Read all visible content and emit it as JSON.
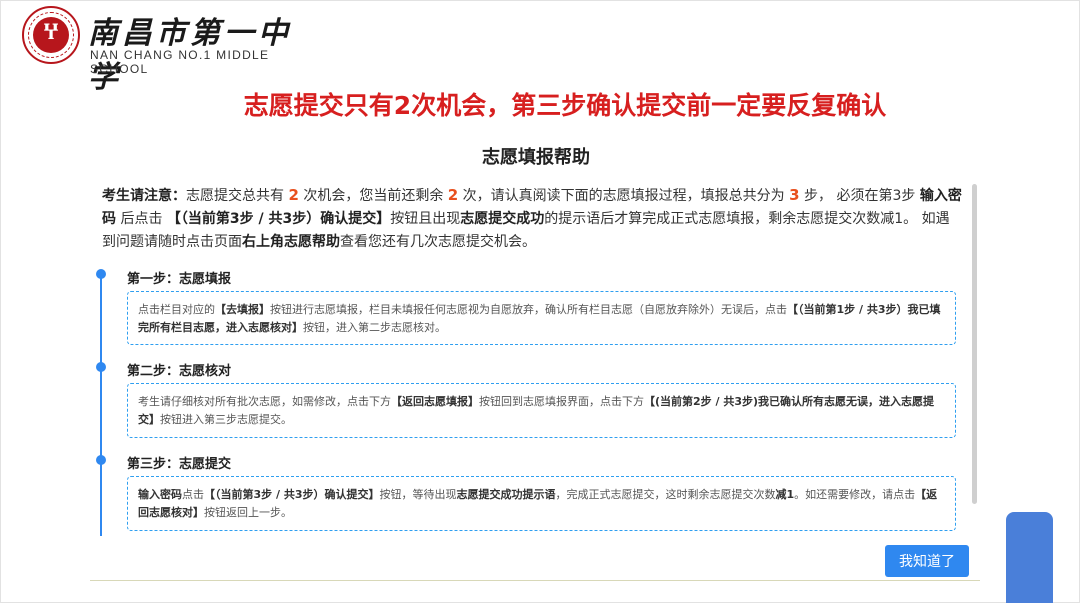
{
  "header": {
    "school_cn": "南昌市第一中学",
    "school_en": "NAN CHANG NO.1 MIDDLE SCHOOL",
    "seal_glyph": "Ⴤ"
  },
  "warning_title": "志愿提交只有2次机会，第三步确认提交前一定要反复确认",
  "help_title": "志愿填报帮助",
  "notice": {
    "p1": "考生请注意：",
    "p2": "志愿提交总共有 ",
    "n1": "2",
    "p3": " 次机会，您当前还剩余 ",
    "n2": "2",
    "p4": " 次，请认真阅读下面的志愿填报过程，填报总共分为 ",
    "n3": "3",
    "p5": " 步， 必须在第3步 ",
    "p6": "输入密码",
    "p7": " 后点击 ",
    "p8": "【（当前第3步 / 共3步）确认提交】",
    "p9": "按钮且出现",
    "p10": "志愿提交成功",
    "p11": "的提示语后才算完成正式志愿填报，剩余志愿提交次数减1。 如遇到问题请随时点击页面",
    "p12": "右上角志愿帮助",
    "p13": "查看您还有几次志愿提交机会。"
  },
  "steps": [
    {
      "title": "第一步：志愿填报",
      "t1": "点击栏目对应的",
      "b1": "【去填报】",
      "t2": "按钮进行志愿填报，栏目未填报任何志愿视为自愿放弃，确认所有栏目志愿（自愿放弃除外）无误后，点击",
      "b2": "【（当前第1步 / 共3步）我已填完所有栏目志愿，进入志愿核对】",
      "t3": "按钮，进入第二步志愿核对。"
    },
    {
      "title": "第二步：志愿核对",
      "t1": "考生请仔细核对所有批次志愿，如需修改，点击下方",
      "b1": "【返回志愿填报】",
      "t2": "按钮回到志愿填报界面，点击下方",
      "b2": "【(当前第2步 / 共3步)我已确认所有志愿无误，进入志愿提交】",
      "t3": "按钮进入第三步志愿提交。"
    },
    {
      "title": "第三步：志愿提交",
      "b0": "输入密码",
      "t1": "点击",
      "b1": "【（当前第3步 / 共3步）确认提交】",
      "t2": "按钮，等待出现",
      "b2": "志愿提交成功提示语",
      "t3": "，完成正式志愿提交，这时剩余志愿提交次数",
      "b3": "减1",
      "t4": "。如还需要修改，请点击",
      "b4": "【返回志愿核对】",
      "t5": "按钮返回上一步。"
    }
  ],
  "ok_button": "我知道了",
  "colors": {
    "warning_red": "#d71f1f",
    "accent_blue": "#2f88f0",
    "number_orange": "#e8501e"
  }
}
